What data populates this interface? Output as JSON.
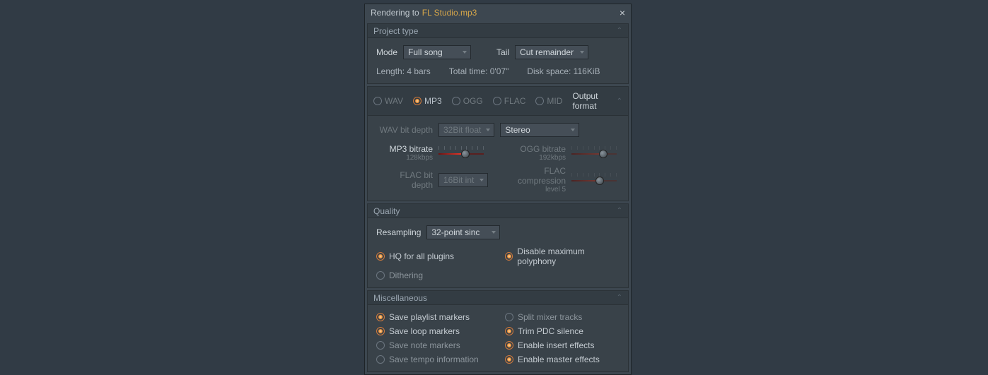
{
  "title_prefix": "Rendering to",
  "title_file": "FL Studio.mp3",
  "sections": {
    "project": "Project type",
    "quality": "Quality",
    "misc": "Miscellaneous"
  },
  "project": {
    "mode_label": "Mode",
    "mode_value": "Full song",
    "tail_label": "Tail",
    "tail_value": "Cut remainder",
    "length": "Length: 4 bars",
    "total_time": "Total time: 0'07\"",
    "disk": "Disk space: 116KiB"
  },
  "formats": {
    "title": "Output format",
    "wav": "WAV",
    "mp3": "MP3",
    "ogg": "OGG",
    "flac": "FLAC",
    "mid": "MID",
    "selected": "mp3"
  },
  "output": {
    "wav_depth_label": "WAV bit depth",
    "wav_depth_value": "32Bit float",
    "channels": "Stereo",
    "mp3_label": "MP3 bitrate",
    "mp3_value": "128kbps",
    "ogg_label": "OGG bitrate",
    "ogg_value": "192kbps",
    "flac_depth_label": "FLAC bit depth",
    "flac_depth_value": "16Bit int",
    "flac_comp_label": "FLAC compression",
    "flac_comp_value": "level 5"
  },
  "quality": {
    "resampling_label": "Resampling",
    "resampling_value": "32-point sinc",
    "hq": "HQ for all plugins",
    "poly": "Disable maximum polyphony",
    "dither": "Dithering"
  },
  "misc": {
    "save_playlist": "Save playlist markers",
    "split_mixer": "Split mixer tracks",
    "save_loop": "Save loop markers",
    "trim_pdc": "Trim PDC silence",
    "save_note": "Save note markers",
    "enable_insert": "Enable insert effects",
    "save_tempo": "Save tempo information",
    "enable_master": "Enable master effects"
  }
}
